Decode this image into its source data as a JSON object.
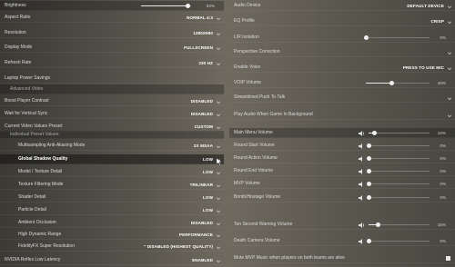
{
  "left": {
    "brightness": {
      "label": "Brightness",
      "value": "93%",
      "level": 0.93
    },
    "aspect_ratio": {
      "label": "Aspect Ratio",
      "value": "NORMAL 4:3"
    },
    "resolution": {
      "label": "Resolution",
      "value": "1280X960"
    },
    "display_mode": {
      "label": "Display Mode",
      "value": "FULLSCREEN"
    },
    "refresh_rate": {
      "label": "Refresh Rate",
      "value": "230 HZ"
    },
    "laptop_power": {
      "label": "Laptop Power Savings"
    },
    "advanced_video": {
      "label": "Advanced Video"
    },
    "boost_contrast": {
      "label": "Boost Player Contrast",
      "value": "DISABLED"
    },
    "vsync": {
      "label": "Wait for Vertical Sync",
      "value": "DISABLED"
    },
    "video_preset": {
      "label": "Current Video Values Preset:",
      "value": "CUSTOM"
    },
    "individual_preset": {
      "label": "Individual Preset Values:"
    },
    "msaa": {
      "label": "Multisampling Anti-Aliasing Mode",
      "value": "2X MSAA"
    },
    "shadow": {
      "label": "Global Shadow Quality",
      "value": "LOW"
    },
    "texture_detail": {
      "label": "Model / Texture Detail",
      "value": "LOW"
    },
    "texture_filter": {
      "label": "Texture Filtering Mode",
      "value": "TRILINEAR"
    },
    "shader": {
      "label": "Shader Detail",
      "value": "LOW"
    },
    "particle": {
      "label": "Particle Detail",
      "value": "LOW"
    },
    "ambient": {
      "label": "Ambient Occlusion",
      "value": "DISABLED"
    },
    "hdr": {
      "label": "High Dynamic Range",
      "value": "PERFORMANCE"
    },
    "fsr": {
      "label": "FidelityFX Super Resolution",
      "value": "\" DISABLED (HIGHEST QUALITY)"
    },
    "reflex": {
      "label": "NVIDIA Reflex Low Latency",
      "value": "ENABLED"
    }
  },
  "right": {
    "audio_device": {
      "label": "Audio Device",
      "value": "DEFAULT DEVICE"
    },
    "eq_profile": {
      "label": "EQ Profile",
      "value": "CRISP"
    },
    "lr_isolation": {
      "label": "L/R Isolation",
      "value": "0%",
      "level": 0.0
    },
    "perspective": {
      "label": "Perspective Correction"
    },
    "enable_voice": {
      "label": "Enable Voice",
      "value": "PRESS TO USE MIC"
    },
    "voip_volume": {
      "label": "VOIP Volume",
      "value": "40%",
      "level": 0.4
    },
    "streamlined_ptt": {
      "label": "Streamlined Push To Talk"
    },
    "play_audio_bg": {
      "label": "Play Audio When Game In Background"
    },
    "main_menu_volume": {
      "label": "Main Menu Volume",
      "value": "10%",
      "level": 0.1
    },
    "round_start_volume": {
      "label": "Round Start Volume",
      "value": "0%",
      "level": 0.0
    },
    "round_action_volume": {
      "label": "Round Action Volume",
      "value": "0%",
      "level": 0.0
    },
    "round_end_volume": {
      "label": "Round End Volume",
      "value": "0%",
      "level": 0.0
    },
    "mvp_volume": {
      "label": "MVP Volume",
      "value": "0%",
      "level": 0.0
    },
    "bomb_volume": {
      "label": "Bomb/Hostage Volume",
      "value": "0%",
      "level": 0.0
    },
    "ten_second_volume": {
      "label": "Ten Second Warning Volume",
      "value": "15%",
      "level": 0.15
    },
    "death_camera_volume": {
      "label": "Death Camera Volume",
      "value": "0%",
      "level": 0.0
    },
    "mute_mvp": {
      "label": "Mute MVP Music when players on both teams are alive"
    }
  },
  "colors": {
    "text": "#dcdcdc",
    "value": "#ffffff",
    "slider_track": "#7a7a74",
    "slider_fill": "#e8e8e8"
  },
  "icons": {
    "dropdown": "chevron-down-icon",
    "volume": "speaker-icon",
    "slider": "slider-knob"
  }
}
